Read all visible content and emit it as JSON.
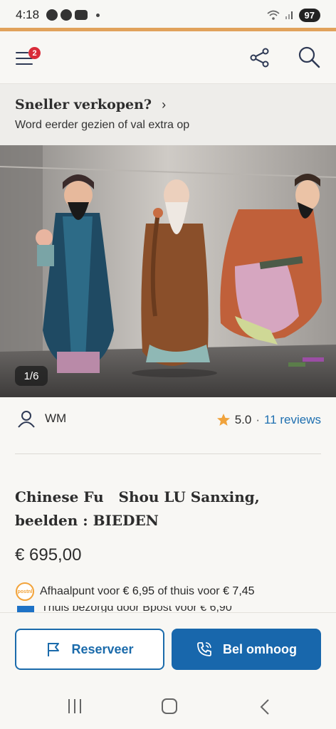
{
  "status_bar": {
    "time": "4:18",
    "battery": "97"
  },
  "header": {
    "notification_count": "2"
  },
  "promo": {
    "title": "Sneller verkopen?",
    "chevron": "›",
    "subtitle": "Word eerder gezien of val extra op"
  },
  "gallery": {
    "counter": "1/6"
  },
  "seller": {
    "name": "WM",
    "rating": "5.0",
    "separator": "·",
    "reviews": "11 reviews"
  },
  "listing": {
    "title": "Chinese Fu   Shou LU Sanxing, beelden : BIEDEN",
    "price": "€ 695,00",
    "shipping_prefix": "Afhaalpunt voor",
    "pickup_price": "€ 6,95",
    "shipping_middle": "of thuis voor",
    "home_price": "€ 7,45",
    "shipping_line2": "Thuis bezorgd door Bpost voor € 6,90",
    "carrier_logo": "postnl"
  },
  "actions": {
    "reserve_label": "Reserveer",
    "call_label": "Bel omhoog"
  },
  "colors": {
    "accent_blue": "#1867ac",
    "brand_orange": "#e1a25b",
    "badge_red": "#d92b39",
    "star": "#f0a33c"
  }
}
